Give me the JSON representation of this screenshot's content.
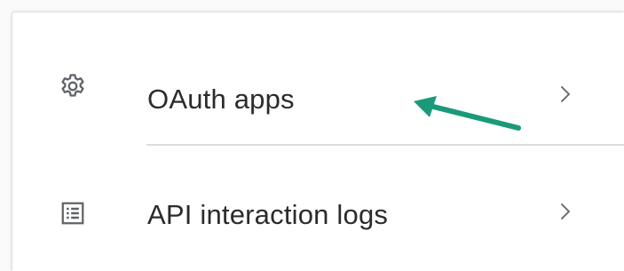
{
  "menu": {
    "items": [
      {
        "label": "OAuth apps",
        "icon": "gear-icon"
      },
      {
        "label": "API interaction logs",
        "icon": "list-icon"
      }
    ]
  },
  "annotation": {
    "arrow_color": "#1a9a7a",
    "points_to": "OAuth apps"
  },
  "colors": {
    "icon": "#5f6368",
    "text": "#2b2b2b",
    "divider": "#dcdcdc"
  }
}
